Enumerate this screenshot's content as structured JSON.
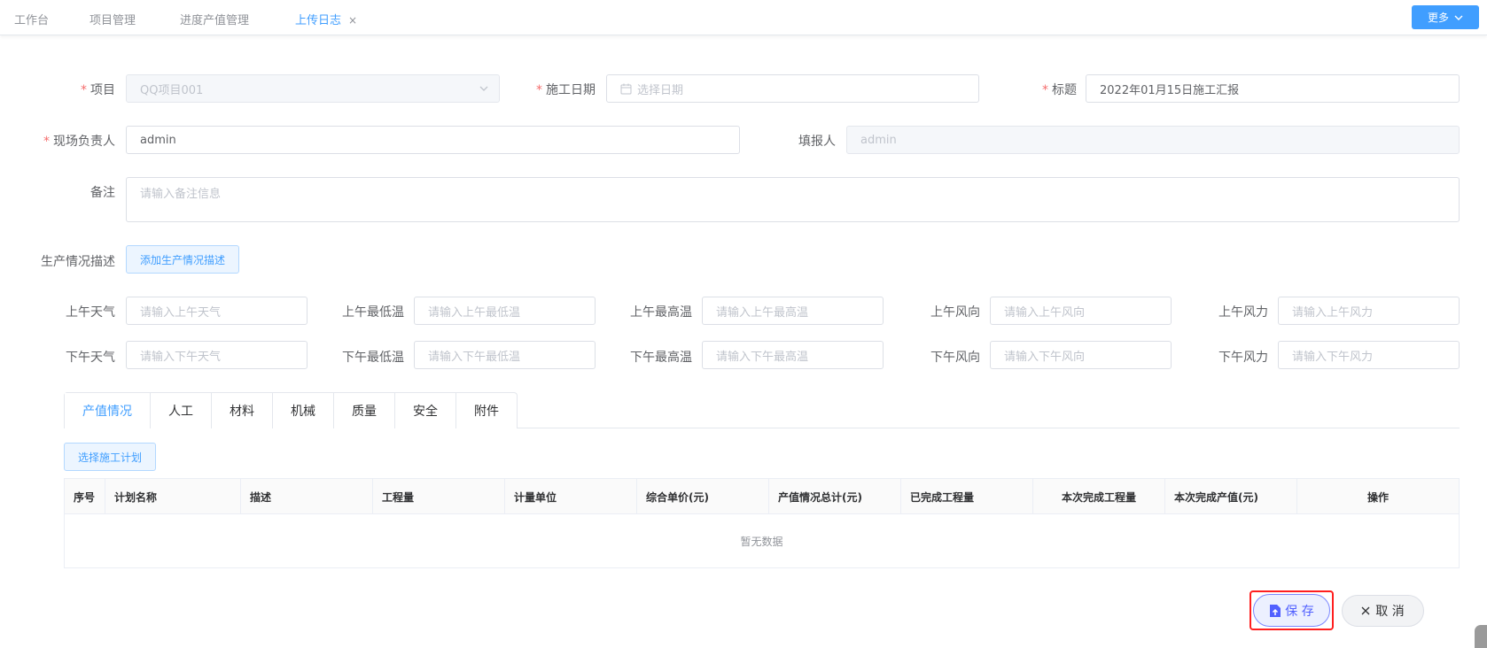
{
  "topbar": {
    "tabs": [
      {
        "label": "工作台"
      },
      {
        "label": "项目管理"
      },
      {
        "label": "进度产值管理"
      },
      {
        "label": "上传日志",
        "active": true
      }
    ],
    "close_symbol": "×",
    "more_label": "更多"
  },
  "form": {
    "required_mark": "*",
    "project": {
      "label": "项目",
      "value": "QQ项目001"
    },
    "date": {
      "label": "施工日期",
      "placeholder": "选择日期"
    },
    "title": {
      "label": "标题",
      "value": "2022年01月15日施工汇报"
    },
    "site_manager": {
      "label": "现场负责人",
      "value": "admin"
    },
    "reporter": {
      "label": "填报人",
      "value": "admin"
    },
    "remark": {
      "label": "备注",
      "placeholder": "请输入备注信息"
    },
    "production": {
      "label": "生产情况描述",
      "button": "添加生产情况描述"
    },
    "weather_am": [
      {
        "label": "上午天气",
        "placeholder": "请输入上午天气"
      },
      {
        "label": "上午最低温",
        "placeholder": "请输入上午最低温"
      },
      {
        "label": "上午最高温",
        "placeholder": "请输入上午最高温"
      },
      {
        "label": "上午风向",
        "placeholder": "请输入上午风向"
      },
      {
        "label": "上午风力",
        "placeholder": "请输入上午风力"
      }
    ],
    "weather_pm": [
      {
        "label": "下午天气",
        "placeholder": "请输入下午天气"
      },
      {
        "label": "下午最低温",
        "placeholder": "请输入下午最低温"
      },
      {
        "label": "下午最高温",
        "placeholder": "请输入下午最高温"
      },
      {
        "label": "下午风向",
        "placeholder": "请输入下午风向"
      },
      {
        "label": "下午风力",
        "placeholder": "请输入下午风力"
      }
    ]
  },
  "content_tabs": [
    "产值情况",
    "人工",
    "材料",
    "机械",
    "质量",
    "安全",
    "附件"
  ],
  "plan_button": "选择施工计划",
  "table": {
    "columns": [
      "序号",
      "计划名称",
      "描述",
      "工程量",
      "计量单位",
      "综合单价(元)",
      "产值情况总计(元)",
      "已完成工程量",
      "本次完成工程量",
      "本次完成产值(元)",
      "操作"
    ],
    "empty_text": "暂无数据"
  },
  "actions": {
    "save_label": "保 存",
    "cancel_label": "取 消",
    "save_icon": "file-upload-icon",
    "cancel_icon": "close-icon"
  },
  "colors": {
    "accent": "#409eff",
    "required": "#f56c6c",
    "highlight_box": "#ff1f1f"
  }
}
